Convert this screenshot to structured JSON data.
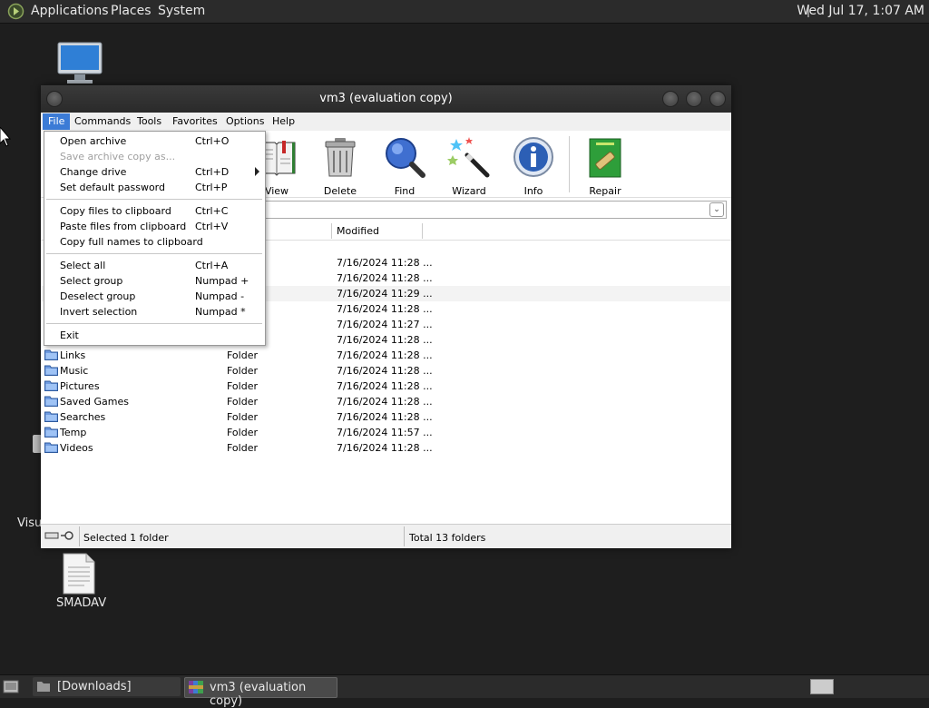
{
  "top_panel": {
    "menus": [
      "Applications",
      "Places",
      "System"
    ],
    "clock": "Wed Jul 17,  1:07 AM"
  },
  "desktop": {
    "icons": [
      {
        "label": "Visu",
        "icon": "partial-icon"
      },
      {
        "label": "SMADAV",
        "icon": "document-icon"
      }
    ]
  },
  "window": {
    "title": "vm3 (evaluation copy)",
    "menubar": [
      "File",
      "Commands",
      "Tools",
      "Favorites",
      "Options",
      "Help"
    ],
    "toolbar": [
      {
        "label": "View",
        "icon": "book-icon"
      },
      {
        "label": "Delete",
        "icon": "trash-can-icon"
      },
      {
        "label": "Find",
        "icon": "magnifier-icon"
      },
      {
        "label": "Wizard",
        "icon": "magic-wand-icon"
      },
      {
        "label": "Info",
        "icon": "info-icon"
      },
      {
        "label": "Repair",
        "icon": "repair-kit-icon"
      }
    ],
    "columns": {
      "modified": "Modified"
    },
    "rows": [
      {
        "name": "",
        "type": "",
        "modified": "7/16/2024 11:28 ..."
      },
      {
        "name": "",
        "type": "",
        "modified": "7/16/2024 11:28 ..."
      },
      {
        "name": "",
        "type": "",
        "modified": "7/16/2024 11:29 ...",
        "selected": true
      },
      {
        "name": "",
        "type": "",
        "modified": "7/16/2024 11:28 ..."
      },
      {
        "name": "",
        "type": "",
        "modified": "7/16/2024 11:27 ..."
      },
      {
        "name": "",
        "type": "",
        "modified": "7/16/2024 11:28 ..."
      },
      {
        "name": "Links",
        "type": "Folder",
        "modified": "7/16/2024 11:28 ..."
      },
      {
        "name": "Music",
        "type": "Folder",
        "modified": "7/16/2024 11:28 ..."
      },
      {
        "name": "Pictures",
        "type": "Folder",
        "modified": "7/16/2024 11:28 ..."
      },
      {
        "name": "Saved Games",
        "type": "Folder",
        "modified": "7/16/2024 11:28 ..."
      },
      {
        "name": "Searches",
        "type": "Folder",
        "modified": "7/16/2024 11:28 ..."
      },
      {
        "name": "Temp",
        "type": "Folder",
        "modified": "7/16/2024 11:57 ..."
      },
      {
        "name": "Videos",
        "type": "Folder",
        "modified": "7/16/2024 11:28 ..."
      }
    ],
    "status": {
      "selected": "Selected 1 folder",
      "total": "Total 13 folders"
    }
  },
  "file_menu": {
    "groups": [
      [
        {
          "label": "Open archive",
          "shortcut": "Ctrl+O"
        },
        {
          "label": "Save archive copy as...",
          "shortcut": "",
          "disabled": true
        },
        {
          "label": "Change drive",
          "shortcut": "Ctrl+D",
          "submenu": true
        },
        {
          "label": "Set default password",
          "shortcut": "Ctrl+P"
        }
      ],
      [
        {
          "label": "Copy files to clipboard",
          "shortcut": "Ctrl+C"
        },
        {
          "label": "Paste files from clipboard",
          "shortcut": "Ctrl+V"
        },
        {
          "label": "Copy full names to clipboard",
          "shortcut": ""
        }
      ],
      [
        {
          "label": "Select all",
          "shortcut": "Ctrl+A"
        },
        {
          "label": "Select group",
          "shortcut": "Numpad +"
        },
        {
          "label": "Deselect group",
          "shortcut": "Numpad -"
        },
        {
          "label": "Invert selection",
          "shortcut": "Numpad *"
        }
      ],
      [
        {
          "label": "Exit",
          "shortcut": ""
        }
      ]
    ]
  },
  "taskbar": {
    "tasks": [
      {
        "label": "[Downloads]"
      },
      {
        "label": "vm3 (evaluation copy)",
        "active": true
      }
    ]
  }
}
